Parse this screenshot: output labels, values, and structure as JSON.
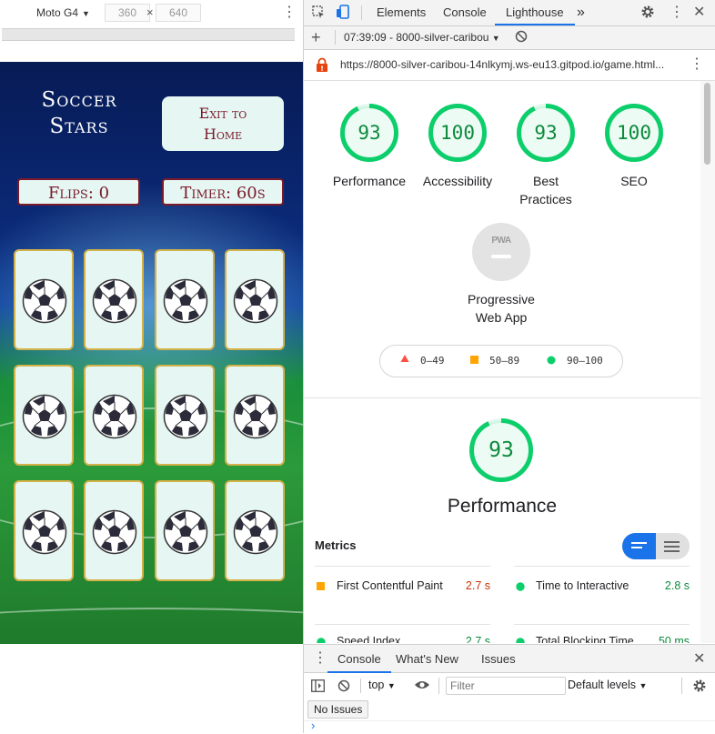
{
  "device_toolbar": {
    "device": "Moto G4",
    "width": "360",
    "height": "640",
    "times": "×"
  },
  "game": {
    "title_line1": "Soccer",
    "title_line2": "Stars",
    "exit_line1": "Exit to",
    "exit_line2": "Home",
    "flips": "Flips: 0",
    "timer": "Timer: 60s",
    "card_count": 12
  },
  "devtools": {
    "tabs": [
      "Elements",
      "Console",
      "Lighthouse"
    ],
    "active_tab": "Lighthouse",
    "more": "»",
    "report_selector": "07:39:09 - 8000-silver-caribou",
    "url": "https://8000-silver-caribou-14nlkymj.ws-eu13.gitpod.io/game.html..."
  },
  "report": {
    "scores": [
      {
        "value": 93,
        "label_line1": "Performance",
        "label_line2": ""
      },
      {
        "value": 100,
        "label_line1": "Accessibility",
        "label_line2": ""
      },
      {
        "value": 93,
        "label_line1": "Best",
        "label_line2": "Practices"
      },
      {
        "value": 100,
        "label_line1": "SEO",
        "label_line2": ""
      }
    ],
    "pwa": {
      "badge": "PWA",
      "label_line1": "Progressive",
      "label_line2": "Web App"
    },
    "legend": {
      "low": "0–49",
      "mid": "50–89",
      "high": "90–100"
    },
    "performance": {
      "value": 93,
      "title": "Performance"
    },
    "metrics_title": "Metrics",
    "metrics": [
      {
        "name": "First Contentful Paint",
        "value": "2.7 s",
        "status": "average"
      },
      {
        "name": "Time to Interactive",
        "value": "2.8 s",
        "status": "pass"
      },
      {
        "name": "Speed Index",
        "value": "2.7 s",
        "status": "pass"
      },
      {
        "name": "Total Blocking Time",
        "value": "50 ms",
        "status": "pass"
      }
    ]
  },
  "drawer": {
    "tabs": [
      "Console",
      "What's New",
      "Issues"
    ],
    "context": "top",
    "filter_placeholder": "Filter",
    "levels": "Default levels",
    "issues_button": "No Issues",
    "prompt": "›"
  },
  "colors": {
    "pass": "#0cce6b",
    "pass_text": "#0c8a3c",
    "average": "#ffa400",
    "average_text": "#c33300",
    "fail": "#ff4e42",
    "accent": "#1a73e8",
    "maroon": "#7a1a2a"
  }
}
